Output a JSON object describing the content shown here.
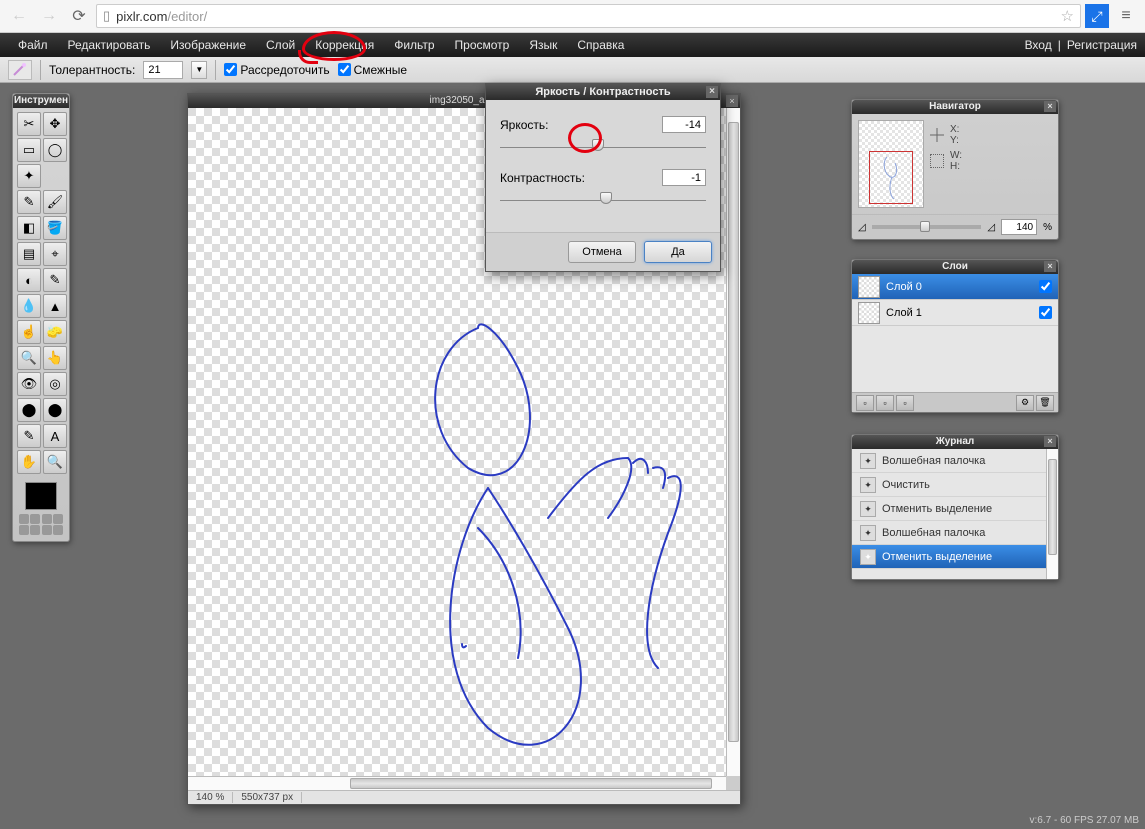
{
  "url_domain": "pixlr.com",
  "url_path": "/editor/",
  "menu": [
    "Файл",
    "Редактировать",
    "Изображение",
    "Слой",
    "Коррекция",
    "Фильтр",
    "Просмотр",
    "Язык",
    "Справка"
  ],
  "menu_right": {
    "login": "Вход",
    "sep": "|",
    "register": "Регистрация"
  },
  "option_bar": {
    "tolerance_label": "Толерантность:",
    "tolerance_value": "21",
    "scatter_label": "Рассредоточить",
    "scatter_checked": true,
    "contiguous_label": "Смежные",
    "contiguous_checked": true
  },
  "tools_title": "Инструмен",
  "tools": [
    "crop-tool",
    "move-tool",
    "marquee-tool",
    "lasso-tool",
    "wand-tool",
    "",
    "pencil-tool",
    "brush-tool",
    "eraser-tool",
    "paint-bucket-tool",
    "gradient-tool",
    "clone-stamp-tool",
    "color-replace-tool",
    "draw-tool",
    "blur-tool",
    "sharpen-tool",
    "smudge-tool",
    "sponge-tool",
    "dodge-tool",
    "burn-tool",
    "red-eye-tool",
    "spot-heal-tool",
    "bloat-tool",
    "pinch-tool",
    "colorpicker-tool",
    "type-tool",
    "hand-tool",
    "zoom-tool"
  ],
  "canvas": {
    "title": "img32050_auto",
    "zoom": "140 %",
    "dimensions": "550x737 px"
  },
  "dialog": {
    "title": "Яркость / Контрастность",
    "brightness_label": "Яркость:",
    "brightness_value": "-14",
    "contrast_label": "Контрастность:",
    "contrast_value": "-1",
    "cancel": "Отмена",
    "ok": "Да"
  },
  "navigator": {
    "title": "Навигатор",
    "x": "X:",
    "y": "Y:",
    "w": "W:",
    "h": "H:",
    "zoom": "140",
    "pct": "%"
  },
  "layers": {
    "title": "Слои",
    "items": [
      {
        "name": "Слой 0",
        "checked": true
      },
      {
        "name": "Слой 1",
        "checked": true
      }
    ]
  },
  "history": {
    "title": "Журнал",
    "items": [
      "Волшебная палочка",
      "Очистить",
      "Отменить выделение",
      "Волшебная палочка",
      "Отменить выделение"
    ]
  },
  "footer": "v:6.7 - 60 FPS 27.07 MB"
}
